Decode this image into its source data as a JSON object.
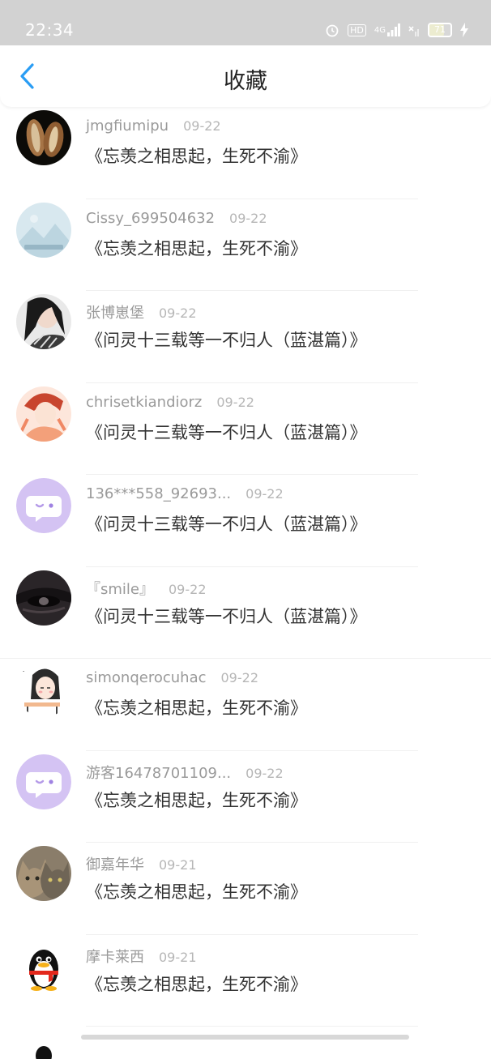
{
  "status_bar": {
    "time": "22:34",
    "hd_label": "HD",
    "network_label": "4G",
    "battery": "71",
    "battery_level": 0.71
  },
  "header": {
    "title": "收藏",
    "back_icon": "chevron-left-icon",
    "accent": "#2a9df4"
  },
  "favorites": [
    {
      "user": "jmgfiumipu",
      "date": "09-22",
      "title": "《忘羡之相思起，生死不渝》",
      "avatar": "shells"
    },
    {
      "user": "Cissy_699504632",
      "date": "09-22",
      "title": "《忘羡之相思起，生死不渝》",
      "avatar": "mountain-placeholder"
    },
    {
      "user": "张博崽堡",
      "date": "09-22",
      "title": "《问灵十三载等一不归人（蓝湛篇）》",
      "avatar": "girl-photo"
    },
    {
      "user": "chrisetkiandiorz",
      "date": "09-22",
      "title": "《问灵十三载等一不归人（蓝湛篇）》",
      "avatar": "anime-boy"
    },
    {
      "user": "136***558_92693...",
      "date": "09-22",
      "title": "《问灵十三载等一不归人（蓝湛篇）》",
      "avatar": "chat-bubble-purple"
    },
    {
      "user": "『smile』",
      "date": "09-22",
      "title": "《问灵十三载等一不归人（蓝湛篇）》",
      "avatar": "dark-eye"
    },
    {
      "user": "simonqerocuhac",
      "date": "09-22",
      "title": "《忘羡之相思起，生死不渝》",
      "avatar": "sleepy-girl"
    },
    {
      "user": "游客16478701109...",
      "date": "09-22",
      "title": "《忘羡之相思起，生死不渝》",
      "avatar": "chat-bubble-purple"
    },
    {
      "user": "御嘉年华",
      "date": "09-21",
      "title": "《忘羡之相思起，生死不渝》",
      "avatar": "cats"
    },
    {
      "user": "摩卡莱西",
      "date": "09-21",
      "title": "《忘羡之相思起，生死不渝》",
      "avatar": "penguin"
    }
  ]
}
